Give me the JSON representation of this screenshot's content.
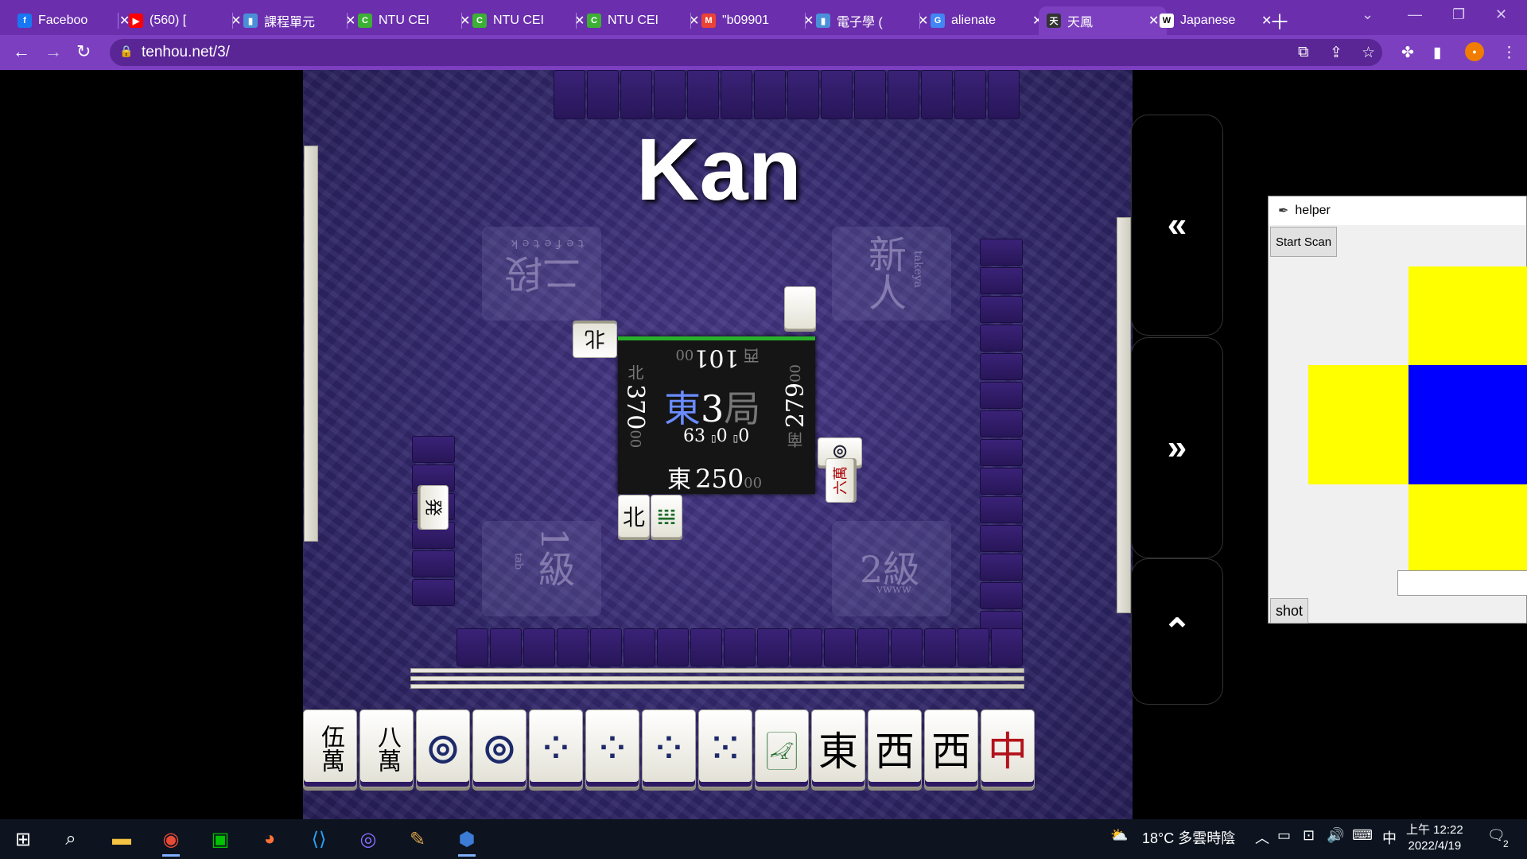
{
  "browser": {
    "tabs": [
      {
        "title": "Faceboo",
        "favicon": "facebook-icon",
        "color": "#1877f2",
        "glyph": "f"
      },
      {
        "title": "(560) [",
        "favicon": "youtube-icon",
        "color": "#ff0000",
        "glyph": "▶"
      },
      {
        "title": "課程單元",
        "favicon": "bar-chart-icon",
        "color": "#4a90d9",
        "glyph": "▮"
      },
      {
        "title": "NTU CEI",
        "favicon": "ntu-cool-icon",
        "color": "#3cb034",
        "glyph": "C"
      },
      {
        "title": "NTU CEI",
        "favicon": "ntu-cool-icon",
        "color": "#3cb034",
        "glyph": "C"
      },
      {
        "title": "NTU CEI",
        "favicon": "ntu-cool-icon",
        "color": "#3cb034",
        "glyph": "C"
      },
      {
        "title": "\"b09901",
        "favicon": "gmail-icon",
        "color": "#ea4335",
        "glyph": "M"
      },
      {
        "title": "電子學 (",
        "favicon": "bar-chart-icon",
        "color": "#4a90d9",
        "glyph": "▮"
      },
      {
        "title": "alienate",
        "favicon": "google-icon",
        "color": "#4285f4",
        "glyph": "G"
      },
      {
        "title": "天鳳",
        "favicon": "tenhou-icon",
        "color": "#333333",
        "glyph": "天",
        "active": true
      },
      {
        "title": "Japanese",
        "favicon": "wikipedia-icon",
        "color": "#ffffff",
        "glyph": "W"
      }
    ],
    "url": "tenhou.net/3/"
  },
  "game": {
    "call_text": "Kan",
    "round": {
      "wind": "東",
      "number": "3",
      "suffix": "局"
    },
    "remaining_tiles": "63",
    "honba": "0",
    "riichi_sticks": "0",
    "scores": {
      "self": {
        "wind": "東",
        "points": "250",
        "sub": "00"
      },
      "right": {
        "wind": "南",
        "points": "279",
        "sub": "00"
      },
      "top": {
        "wind": "西",
        "points": "101",
        "sub": "00"
      },
      "left": {
        "wind": "北",
        "points": "370",
        "sub": "00"
      }
    },
    "players": {
      "top_left": {
        "rank": "二段",
        "name": "ｔｅｆｅｔｅｋ"
      },
      "top_right": {
        "rank": "新人",
        "name": "takeya"
      },
      "bottom_left": {
        "rank": "1級",
        "name": "tab"
      },
      "bottom_right": {
        "rank": "2級",
        "name": "vwww"
      }
    },
    "hand": [
      {
        "glyph": "伍萬",
        "suit": "man"
      },
      {
        "glyph": "八萬",
        "suit": "man"
      },
      {
        "glyph": "⊚",
        "suit": "pin"
      },
      {
        "glyph": "⊚",
        "suit": "pin"
      },
      {
        "glyph": "⁘",
        "suit": "pin"
      },
      {
        "glyph": "⁘",
        "suit": "pin"
      },
      {
        "glyph": "⁘",
        "suit": "pin"
      },
      {
        "glyph": "⁙",
        "suit": "pin"
      },
      {
        "glyph": "🀐",
        "suit": "sou"
      },
      {
        "glyph": "東",
        "suit": "honor"
      },
      {
        "glyph": "西",
        "suit": "honor"
      },
      {
        "glyph": "西",
        "suit": "honor"
      },
      {
        "glyph": "中",
        "suit": "honor-red"
      }
    ],
    "discards": {
      "self": [
        "北",
        "𝍐"
      ],
      "top": [
        "北"
      ],
      "right": [
        "⊚",
        "六萬"
      ],
      "left": [
        "発"
      ]
    }
  },
  "overlay": {
    "prev_label": "«",
    "next_label": "»",
    "up_label": "⌃"
  },
  "helper": {
    "title": "helper",
    "scan_button": "Start Scan",
    "shot_button": "shot",
    "colors": {
      "yellow": "#ffff00",
      "blue": "#0000ff"
    }
  },
  "taskbar": {
    "weather": "18°C 多雲時陰",
    "ime": "中",
    "time": "上午 12:22",
    "date": "2022/4/19",
    "notifications": "2"
  }
}
